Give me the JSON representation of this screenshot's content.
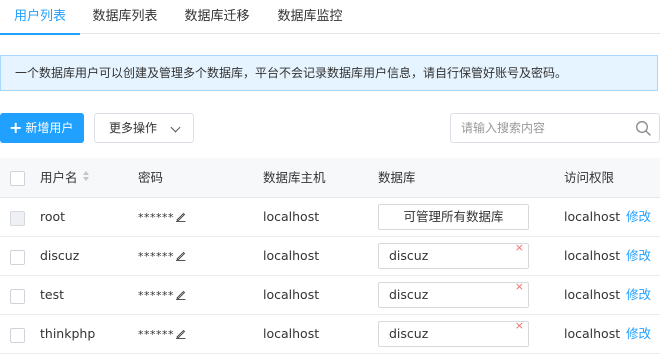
{
  "tabs": [
    {
      "label": "用户列表",
      "active": true
    },
    {
      "label": "数据库列表",
      "active": false
    },
    {
      "label": "数据库迁移",
      "active": false
    },
    {
      "label": "数据库监控",
      "active": false
    }
  ],
  "notice": "一个数据库用户可以创建及管理多个数据库，平台不会记录数据库用户信息，请自行保管好账号及密码。",
  "toolbar": {
    "add_icon": "+",
    "add_label": "新增用户",
    "more_label": "更多操作",
    "search_placeholder": "请输入搜索内容"
  },
  "table": {
    "headers": {
      "name": "用户名",
      "password": "密码",
      "host": "数据库主机",
      "database": "数据库",
      "access": "访问权限"
    },
    "rows": [
      {
        "name": "root",
        "password": "******",
        "host": "localhost",
        "database": "可管理所有数据库",
        "removable": false,
        "access": "localhost",
        "action": "修改"
      },
      {
        "name": "discuz",
        "password": "******",
        "host": "localhost",
        "database": "discuz",
        "removable": true,
        "access": "localhost",
        "action": "修改"
      },
      {
        "name": "test",
        "password": "******",
        "host": "localhost",
        "database": "discuz",
        "removable": true,
        "access": "localhost",
        "action": "修改"
      },
      {
        "name": "thinkphp",
        "password": "******",
        "host": "localhost",
        "database": "discuz",
        "removable": true,
        "access": "localhost",
        "action": "修改"
      }
    ],
    "remove_glyph": "×"
  },
  "colors": {
    "accent": "#20a0ff",
    "notice_bg": "#e6f4ff",
    "notice_border": "#a7d7ff",
    "remove": "#f56c6c"
  },
  "icons": {
    "add": "plus-icon",
    "more": "chevron-down-icon",
    "search": "search-icon",
    "edit_password": "pencil-icon",
    "sort": "sort-icon",
    "remove": "close-icon"
  }
}
